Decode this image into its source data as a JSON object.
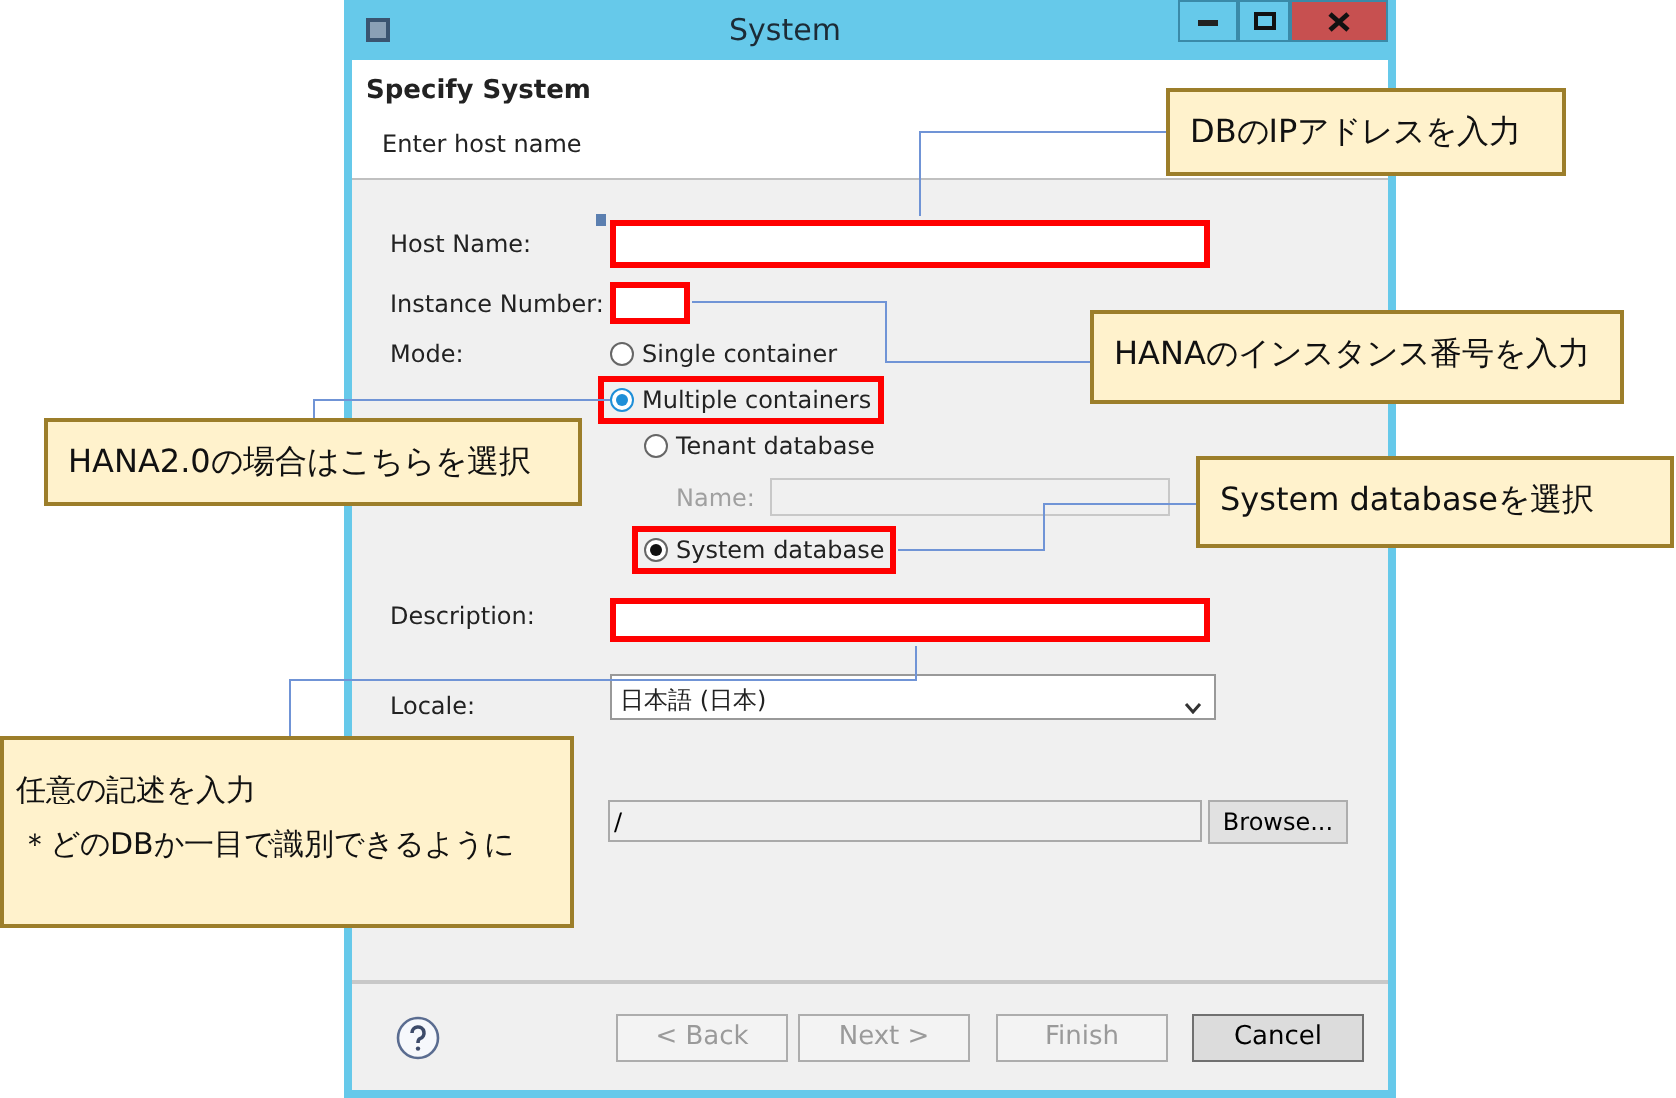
{
  "window": {
    "title": "System"
  },
  "header": {
    "title": "Specify System",
    "subtitle": "Enter host name"
  },
  "host_name": {
    "label": "Host Name:",
    "highlighted": true
  },
  "instance_number": {
    "label": "Instance Number:",
    "highlighted": true
  },
  "mode": {
    "label": "Mode:",
    "options": [
      {
        "label": "Single container",
        "selected": false,
        "focused": false,
        "highlighted": false
      },
      {
        "label": "Multiple containers",
        "selected": true,
        "focused": true,
        "highlighted": true
      }
    ]
  },
  "database": {
    "options": [
      {
        "label": "Tenant database",
        "selected": false,
        "highlighted": false
      },
      {
        "label": "System database",
        "selected": true,
        "highlighted": true
      }
    ],
    "name": {
      "label": "Name:",
      "disabled": true
    }
  },
  "description": {
    "label": "Description:",
    "highlighted": true
  },
  "locale": {
    "label": "Locale:",
    "value": "日本語 (日本)"
  },
  "path": {
    "value": "/",
    "button": "Browse..."
  },
  "buttons": [
    {
      "label": "< Back",
      "disabled": true
    },
    {
      "label": "Next >",
      "disabled": true
    },
    {
      "label": "Finish",
      "disabled": true
    },
    {
      "label": "Cancel",
      "disabled": false
    }
  ],
  "callouts": [
    {
      "lines": [
        "DBのIPアドレスを入力"
      ]
    },
    {
      "lines": [
        "HANAのインスタンス番号を入力"
      ]
    },
    {
      "lines": [
        "HANA2.0の場合はこちらを選択"
      ]
    },
    {
      "lines": [
        "System databaseを選択"
      ]
    },
    {
      "lines": [
        "任意の記述を入力",
        "＊どのDBか一目で識別できるように"
      ]
    }
  ]
}
